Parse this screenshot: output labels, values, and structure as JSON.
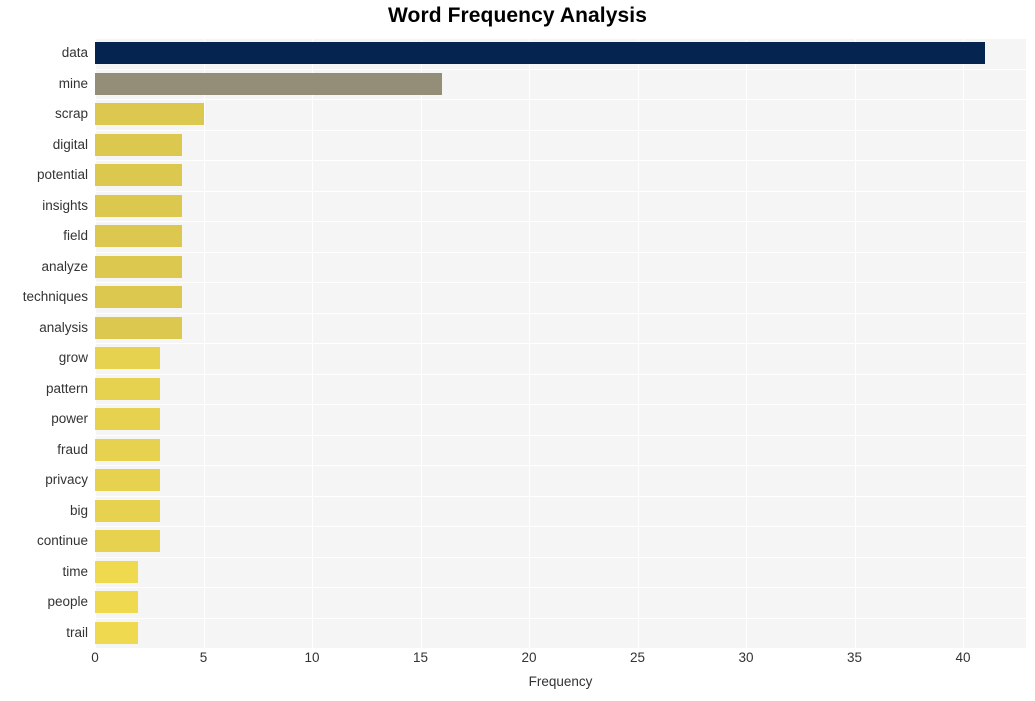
{
  "chart_data": {
    "type": "bar",
    "orientation": "horizontal",
    "title": "Word Frequency Analysis",
    "xlabel": "Frequency",
    "ylabel": "",
    "categories": [
      "data",
      "mine",
      "scrap",
      "digital",
      "potential",
      "insights",
      "field",
      "analyze",
      "techniques",
      "analysis",
      "grow",
      "pattern",
      "power",
      "fraud",
      "privacy",
      "big",
      "continue",
      "time",
      "people",
      "trail"
    ],
    "values": [
      41,
      16,
      5,
      4,
      4,
      4,
      4,
      4,
      4,
      4,
      3,
      3,
      3,
      3,
      3,
      3,
      3,
      2,
      2,
      2
    ],
    "bar_colors": [
      "#052450",
      "#948e78",
      "#dcc84e",
      "#dcc84e",
      "#dcc84e",
      "#dcc84e",
      "#dcc84e",
      "#dcc84e",
      "#dcc84e",
      "#dcc84e",
      "#e6d24f",
      "#e6d24f",
      "#e6d24f",
      "#e6d24f",
      "#e6d24f",
      "#e6d24f",
      "#e6d24f",
      "#efd94f",
      "#efd94f",
      "#efd94f"
    ],
    "xlim": [
      0,
      42.9
    ],
    "xticks": [
      0,
      5,
      10,
      15,
      20,
      25,
      30,
      35,
      40
    ],
    "xtick_labels": [
      "0",
      "5",
      "10",
      "15",
      "20",
      "25",
      "30",
      "35",
      "40"
    ],
    "grid": true,
    "grid_color": "#ffffff",
    "plot_background": "#f5f5f5",
    "figure_background": "#ffffff",
    "legend": null
  },
  "figure": {
    "title": "Word Frequency Analysis",
    "xlabel": "Frequency"
  }
}
